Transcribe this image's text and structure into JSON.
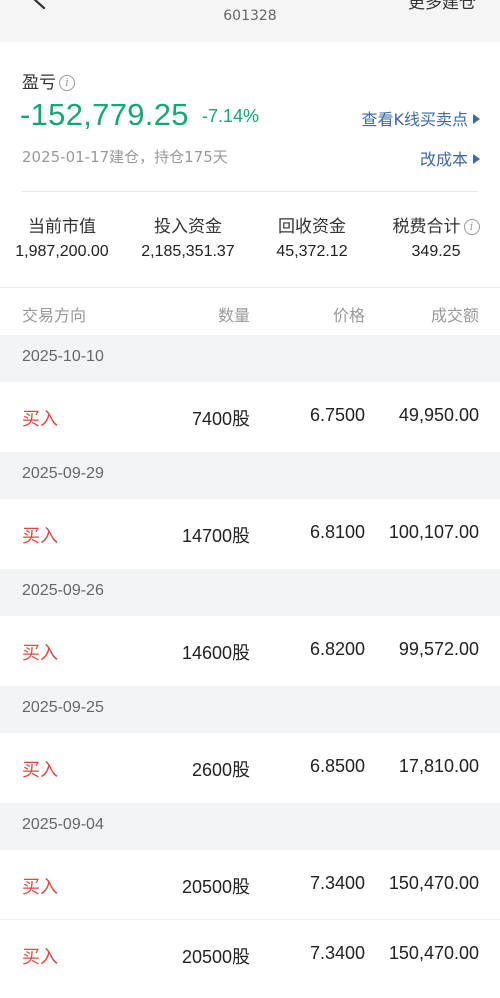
{
  "header": {
    "stock_code": "601328",
    "more_label": "更多建仓"
  },
  "summary": {
    "pnl_label": "盈亏",
    "pnl_value": "-152,779.25",
    "pnl_pct": "-7.14%",
    "kline_link": "查看K线买卖点",
    "position_info": "2025-01-17建仓，持仓175天",
    "change_cost_link": "改成本",
    "stats": [
      {
        "label": "当前市值",
        "value": "1,987,200.00"
      },
      {
        "label": "投入资金",
        "value": "2,185,351.37"
      },
      {
        "label": "回收资金",
        "value": "45,372.12"
      },
      {
        "label": "税费合计",
        "value": "349.25"
      }
    ],
    "colors": {
      "loss": "#15a677",
      "link": "#3a6aa8",
      "buy": "#e5453c"
    }
  },
  "table": {
    "headers": {
      "direction": "交易方向",
      "quantity": "数量",
      "price": "价格",
      "amount": "成交额"
    },
    "groups": [
      {
        "date": "2025-10-10",
        "trades": [
          {
            "direction": "买入",
            "quantity": "7400股",
            "price": "6.7500",
            "amount": "49,950.00"
          }
        ]
      },
      {
        "date": "2025-09-29",
        "trades": [
          {
            "direction": "买入",
            "quantity": "14700股",
            "price": "6.8100",
            "amount": "100,107.00"
          }
        ]
      },
      {
        "date": "2025-09-26",
        "trades": [
          {
            "direction": "买入",
            "quantity": "14600股",
            "price": "6.8200",
            "amount": "99,572.00"
          }
        ]
      },
      {
        "date": "2025-09-25",
        "trades": [
          {
            "direction": "买入",
            "quantity": "2600股",
            "price": "6.8500",
            "amount": "17,810.00"
          }
        ]
      },
      {
        "date": "2025-09-04",
        "trades": [
          {
            "direction": "买入",
            "quantity": "20500股",
            "price": "7.3400",
            "amount": "150,470.00"
          },
          {
            "direction": "买入",
            "quantity": "20500股",
            "price": "7.3400",
            "amount": "150,470.00"
          }
        ]
      }
    ]
  }
}
